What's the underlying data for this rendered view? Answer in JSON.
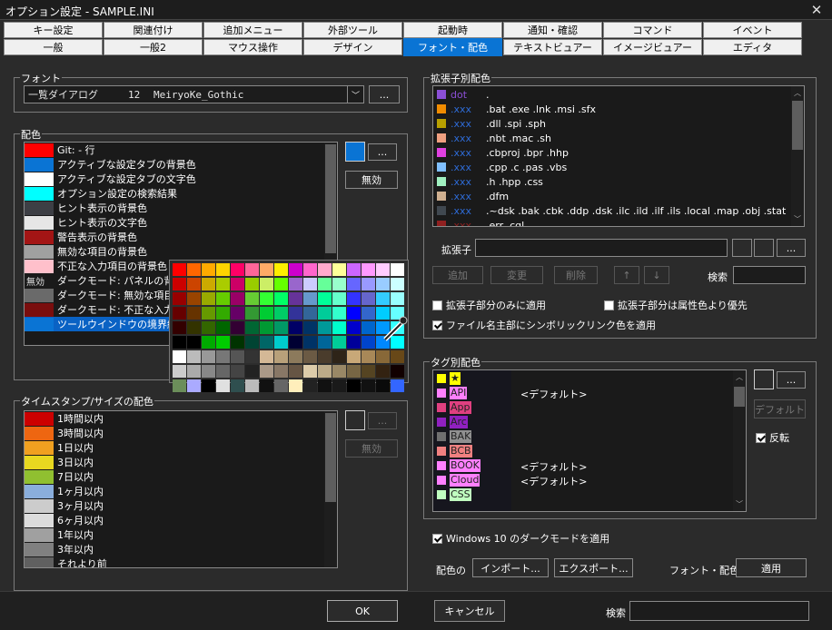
{
  "window": {
    "title": "オプション設定 - SAMPLE.INI"
  },
  "tabs_row1": [
    "キー設定",
    "関連付け",
    "追加メニュー",
    "外部ツール",
    "起動時",
    "通知・確認",
    "コマンド",
    "イベント"
  ],
  "tabs_row2": [
    "一般",
    "一般2",
    "マウス操作",
    "デザイン",
    "フォント・配色",
    "テキストビュアー",
    "イメージビュアー",
    "エディタ"
  ],
  "active_tab": "フォント・配色",
  "font_group": {
    "label": "フォント",
    "target": "一覧ダイアログ",
    "size": "12",
    "face": "MeiryoKe_Gothic",
    "browse": "..."
  },
  "color_group": {
    "label": "配色",
    "browse": "...",
    "disable": "無効",
    "items": [
      {
        "swatch": "#ff0000",
        "label": "Git: - 行"
      },
      {
        "swatch": "#0a74d4",
        "label": "アクティブな設定タブの背景色"
      },
      {
        "swatch": "#ffffff",
        "label": "アクティブな設定タブの文字色"
      },
      {
        "swatch": "#00ffff",
        "label": "オプション設定の検索結果"
      },
      {
        "swatch": "#3d3f45",
        "label": "ヒント表示の背景色"
      },
      {
        "swatch": "#e6e6e6",
        "label": "ヒント表示の文字色"
      },
      {
        "swatch": "#a31515",
        "label": "警告表示の背景色"
      },
      {
        "swatch": "#a0a0a0",
        "label": "無効な項目の背景色"
      },
      {
        "swatch": "#ffc0cb",
        "label": "不正な入力項目の背景色"
      },
      {
        "swatch": "",
        "swatch_text": "無効",
        "label": "ダークモード: パネルの背景色"
      },
      {
        "swatch": "#6a6a6a",
        "label": "ダークモード: 無効な項目の背景色"
      },
      {
        "swatch": "#7a0e0e",
        "label": "ダークモード: 不正な入力項目"
      },
      {
        "swatch": "#0a74d4",
        "label": "ツールウインドウの境界線"
      }
    ]
  },
  "palette": {
    "rows": [
      [
        "#ff0000",
        "#ff6600",
        "#ffaa00",
        "#ffd400",
        "#ff0066",
        "#ff6699",
        "#ffaa66",
        "#ffee00",
        "#cc00cc",
        "#ff66cc",
        "#ffaacc",
        "#ffff99",
        "#cc66ff",
        "#ff99ff",
        "#ffccff",
        "#ffffff"
      ],
      [
        "#cc0000",
        "#cc4400",
        "#ccaa00",
        "#aacc00",
        "#cc0066",
        "#99cc00",
        "#ccee66",
        "#66ff00",
        "#9966cc",
        "#ccccff",
        "#66ff99",
        "#99ffcc",
        "#6666ff",
        "#9999ff",
        "#99ccff",
        "#ccffff"
      ],
      [
        "#990000",
        "#994400",
        "#99aa00",
        "#66cc00",
        "#990066",
        "#66cc33",
        "#33ff33",
        "#00ff66",
        "#663399",
        "#6699cc",
        "#00ff99",
        "#66ffcc",
        "#3333ff",
        "#6666cc",
        "#33ccff",
        "#99ffff"
      ],
      [
        "#660000",
        "#663300",
        "#669900",
        "#33aa00",
        "#660066",
        "#339933",
        "#00cc33",
        "#00cc66",
        "#333399",
        "#336699",
        "#00cc99",
        "#33ffcc",
        "#0000ff",
        "#3366cc",
        "#00ccff",
        "#66ffff"
      ],
      [
        "#330000",
        "#333300",
        "#336600",
        "#006600",
        "#330033",
        "#006633",
        "#009933",
        "#009966",
        "#000066",
        "#003366",
        "#009999",
        "#00ffcc",
        "#0000cc",
        "#0066cc",
        "#0099ff",
        "#33ffff"
      ],
      [
        "#000000",
        "#000000",
        "#00aa00",
        "#00cc00",
        "#003300",
        "#004433",
        "#006666",
        "#00cccc",
        "#000033",
        "#003366",
        "#006699",
        "#00cc99",
        "#000099",
        "#0044cc",
        "#0088ff",
        "#00ffff"
      ],
      [
        "#ffffff",
        "#bbbbbb",
        "#999999",
        "#777777",
        "#555555",
        "#333333",
        "#d4b896",
        "#b8a07a",
        "#8c7a5c",
        "#6b5a44",
        "#4a3c2c",
        "#2e2418",
        "#c8a878",
        "#a88858",
        "#886838",
        "#684818"
      ],
      [
        "#cccccc",
        "#aaaaaa",
        "#888888",
        "#666666",
        "#444444",
        "#222222",
        "#aa9988",
        "#887766",
        "#665544",
        "#ddccaa",
        "#bbaa88",
        "#998866",
        "#776644",
        "#554422",
        "#332211",
        "#110000"
      ],
      [
        "#6b8e5a",
        "#aaaaff",
        "#000000",
        "#e0e0e0",
        "#2f4f4f",
        "#bbbbbb",
        "#111111",
        "#666666",
        "#ffeebb",
        "#222222",
        "#111111",
        "#1a1a1a",
        "#000000",
        "#111111",
        "#0a0a0a",
        "#3366ff"
      ]
    ]
  },
  "timestamp_group": {
    "label": "タイムスタンプ/サイズの配色",
    "browse": "...",
    "disable": "無効",
    "items": [
      {
        "swatch": "#cc0000",
        "label": "1時間以内"
      },
      {
        "swatch": "#ee6611",
        "label": "3時間以内"
      },
      {
        "swatch": "#f0a020",
        "label": "1日以内"
      },
      {
        "swatch": "#e8d820",
        "label": "3日以内"
      },
      {
        "swatch": "#90c030",
        "label": "7日以内"
      },
      {
        "swatch": "#8aaedc",
        "label": "1ヶ月以内"
      },
      {
        "swatch": "#cccccc",
        "label": "3ヶ月以内"
      },
      {
        "swatch": "#dcdcdc",
        "label": "6ヶ月以内"
      },
      {
        "swatch": "#a0a0a0",
        "label": "1年以内"
      },
      {
        "swatch": "#808080",
        "label": "3年以内"
      },
      {
        "swatch": "#606060",
        "label": "それより前"
      }
    ]
  },
  "ext_group": {
    "label": "拡張子別配色",
    "ext_label": "拡張子",
    "browse": "...",
    "add": "追加",
    "change": "変更",
    "delete": "削除",
    "up": "↑",
    "down": "↓",
    "search": "検索",
    "opt1": "拡張子部分のみに適用",
    "opt2": "拡張子部分は属性色より優先",
    "opt3": "ファイル名主部にシンボリックリンク色を適用",
    "items": [
      {
        "swatch": "#8b4fd6",
        "tag": "dot",
        "exts": "."
      },
      {
        "swatch": "#f08c00",
        "tag": ".xxx",
        "exts": ".bat .exe .lnk .msi .sfx"
      },
      {
        "swatch": "#b8a000",
        "tag": ".xxx",
        "exts": ".dll .spi .sph"
      },
      {
        "swatch": "#f0a080",
        "tag": ".xxx",
        "exts": ".nbt .mac .sh"
      },
      {
        "swatch": "#e040e0",
        "tag": ".xxx",
        "exts": ".cbproj .bpr .hhp"
      },
      {
        "swatch": "#80c0ff",
        "tag": ".xxx",
        "exts": ".cpp .c .pas .vbs"
      },
      {
        "swatch": "#a0f0c0",
        "tag": ".xxx",
        "exts": ".h .hpp .css"
      },
      {
        "swatch": "#d0b090",
        "tag": ".xxx",
        "exts": ".dfm"
      },
      {
        "swatch": "#404850",
        "tag": ".xxx",
        "exts": ".~dsk .bak .cbk .ddp .dsk .ilc .ild .ilf .ils .local .map .obj .stat"
      },
      {
        "swatch": "#902020",
        "tag": ".xxx",
        "exts": ".err .cgl"
      }
    ]
  },
  "tag_group": {
    "label": "タグ別配色",
    "browse": "...",
    "default_btn": "デフォルト",
    "invert": "反転",
    "items": [
      {
        "swatch": "#ffff00",
        "name": "★",
        "bg": "#ffff00",
        "value": ""
      },
      {
        "swatch": "#ff80ff",
        "name": "API",
        "bg": "#ff80ff",
        "value": "<デフォルト>"
      },
      {
        "swatch": "#e04080",
        "name": "App",
        "bg": "#e04080",
        "value": ""
      },
      {
        "swatch": "#9020c0",
        "name": "Arc",
        "bg": "#9020c0",
        "value": ""
      },
      {
        "swatch": "#707070",
        "name": "BAK",
        "bg": "#909090",
        "value": ""
      },
      {
        "swatch": "#f08080",
        "name": "BCB",
        "bg": "#f08080",
        "value": ""
      },
      {
        "swatch": "#ff80ff",
        "name": "BOOK",
        "bg": "#ff80ff",
        "value": "<デフォルト>"
      },
      {
        "swatch": "#ff80ff",
        "name": "Cloud",
        "bg": "#ff80ff",
        "value": "<デフォルト>"
      },
      {
        "swatch": "#c0ffc0",
        "name": "CSS",
        "bg": "#c0ffc0",
        "value": ""
      }
    ]
  },
  "darkmode": "Windows 10 のダークモードを適用",
  "bottom": {
    "color_label": "配色の",
    "import": "インポート...",
    "export": "エクスポート...",
    "fontcolor_label": "フォント・配色の",
    "apply": "適用"
  },
  "footer": {
    "ok": "OK",
    "cancel": "キャンセル",
    "search": "検索"
  }
}
